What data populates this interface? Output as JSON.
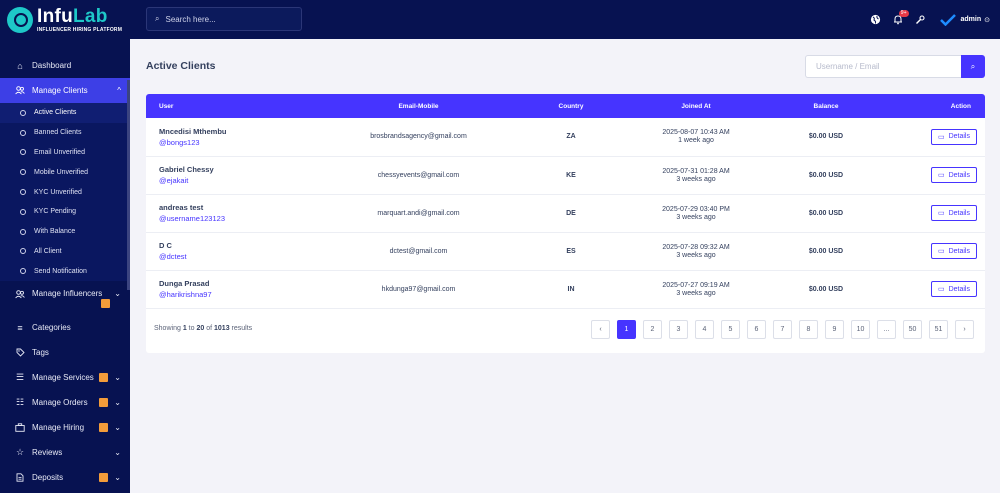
{
  "brand": {
    "name_part1": "Infu",
    "name_part2": "Lab",
    "tagline": "INFLUENCER HIRING PLATFORM",
    "accent_color": "#1ec8c8"
  },
  "topbar": {
    "search_placeholder": "Search here...",
    "notification_count": "9+",
    "user_name": "admin"
  },
  "sidebar": {
    "items": [
      {
        "label": "Dashboard",
        "icon": "home-icon"
      },
      {
        "label": "Manage Clients",
        "icon": "users-icon"
      },
      {
        "label": "Manage Influencers",
        "icon": "users-icon"
      },
      {
        "label": "Categories",
        "icon": "menu-icon"
      },
      {
        "label": "Tags",
        "icon": "tag-icon"
      },
      {
        "label": "Manage Services",
        "icon": "list-icon"
      },
      {
        "label": "Manage Orders",
        "icon": "list-icon"
      },
      {
        "label": "Manage Hiring",
        "icon": "briefcase-icon"
      },
      {
        "label": "Reviews",
        "icon": "star-icon"
      },
      {
        "label": "Deposits",
        "icon": "document-icon"
      }
    ],
    "client_submenu": [
      "Active Clients",
      "Banned Clients",
      "Email Unverified",
      "Mobile Unverified",
      "KYC Unverified",
      "KYC Pending",
      "With Balance",
      "All Client",
      "Send Notification"
    ]
  },
  "page": {
    "title": "Active Clients",
    "filter_placeholder": "Username / Email"
  },
  "table": {
    "headers": [
      "User",
      "Email-Mobile",
      "Country",
      "Joined At",
      "Balance",
      "Action"
    ],
    "rows": [
      {
        "name": "Mncedisi Mthembu",
        "handle": "@bongs123",
        "email": "brosbrandsagency@gmail.com",
        "country": "ZA",
        "joined": "2025-08-07 10:43 AM",
        "ago": "1 week ago",
        "balance": "$0.00 USD",
        "action": "Details"
      },
      {
        "name": "Gabriel Chessy",
        "handle": "@ejakait",
        "email": "chessyevents@gmail.com",
        "country": "KE",
        "joined": "2025-07-31 01:28 AM",
        "ago": "3 weeks ago",
        "balance": "$0.00 USD",
        "action": "Details"
      },
      {
        "name": "andreas test",
        "handle": "@username123123",
        "email": "marquart.andi@gmail.com",
        "country": "DE",
        "joined": "2025-07-29 03:40 PM",
        "ago": "3 weeks ago",
        "balance": "$0.00 USD",
        "action": "Details"
      },
      {
        "name": "D C",
        "handle": "@dctest",
        "email": "dctest@gmail.com",
        "country": "ES",
        "joined": "2025-07-28 09:32 AM",
        "ago": "3 weeks ago",
        "balance": "$0.00 USD",
        "action": "Details"
      },
      {
        "name": "Dunga Prasad",
        "handle": "@harikrishna97",
        "email": "hkdunga97@gmail.com",
        "country": "IN",
        "joined": "2025-07-27 09:19 AM",
        "ago": "3 weeks ago",
        "balance": "$0.00 USD",
        "action": "Details"
      }
    ]
  },
  "footer": {
    "showing_prefix": "Showing",
    "from": "1",
    "to_word": "to",
    "to": "20",
    "of_word": "of",
    "total": "1013",
    "results_word": "results"
  },
  "pagination": {
    "prev": "‹",
    "pages": [
      "1",
      "2",
      "3",
      "4",
      "5",
      "6",
      "7",
      "8",
      "9",
      "10",
      "...",
      "50",
      "51"
    ],
    "current": "1",
    "next": "›"
  }
}
